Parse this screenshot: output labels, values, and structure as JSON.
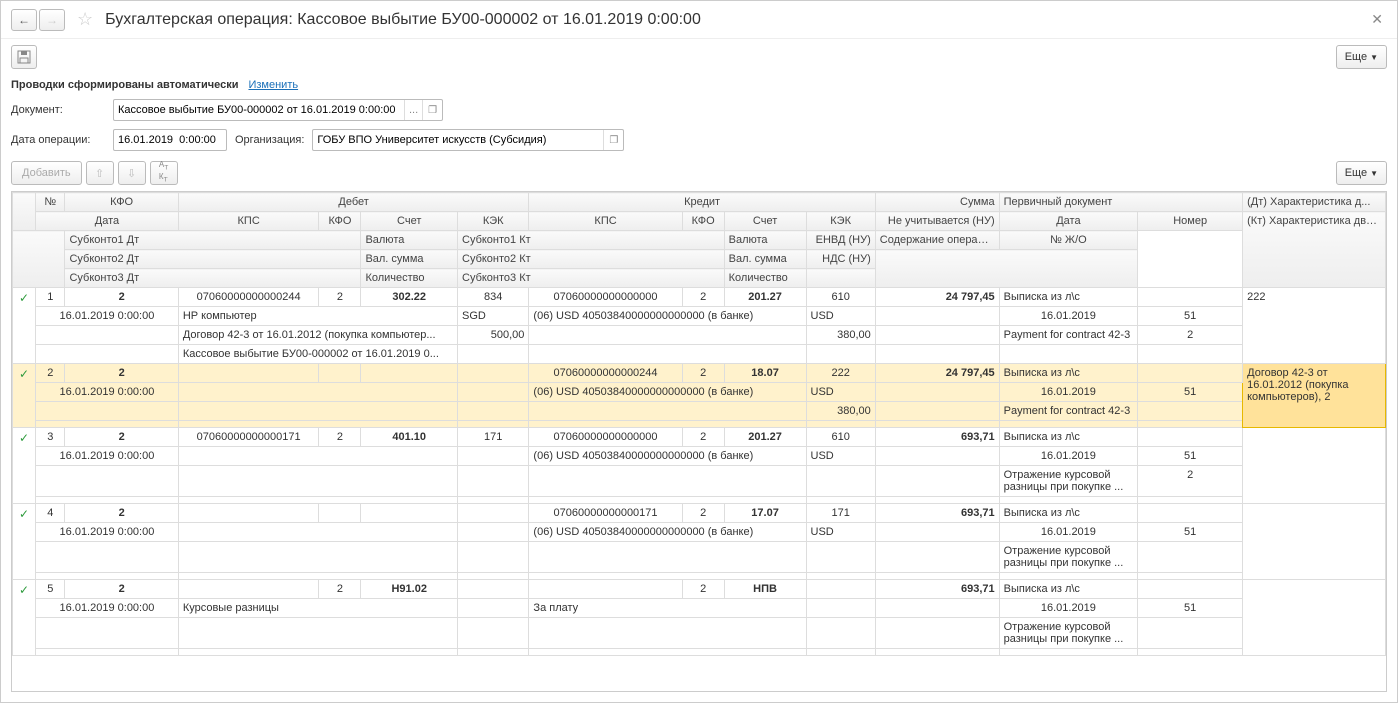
{
  "header": {
    "title": "Бухгалтерская операция: Кассовое выбытие БУ00-000002 от 16.01.2019 0:00:00"
  },
  "toolbar": {
    "more_label": "Еще"
  },
  "info": {
    "auto_text": "Проводки сформированы автоматически",
    "change_link": "Изменить"
  },
  "form": {
    "document_label": "Документ:",
    "document_value": "Кассовое выбытие БУ00-000002 от 16.01.2019 0:00:00",
    "date_label": "Дата операции:",
    "date_value": "16.01.2019  0:00:00",
    "org_label": "Организация:",
    "org_value": "ГОБУ ВПО Университет искусств (Субсидия)"
  },
  "buttons": {
    "add_label": "Добавить",
    "dtk_label": "Дт\nКт"
  },
  "grid": {
    "h_no": "№",
    "h_kfo": "КФО",
    "h_date": "Дата",
    "h_debit": "Дебет",
    "h_credit": "Кредит",
    "h_sum": "Сумма",
    "h_prim": "Первичный документ",
    "h_char_dt": "(Дт) Характеристика д...",
    "h_char_kt": "(Кт) Характеристика движения",
    "h_kps": "КПС",
    "h_kfo2": "КФО",
    "h_acct": "Счет",
    "h_kek": "КЭК",
    "h_ne": "Не учитывается (НУ)",
    "h_pdate": "Дата",
    "h_pnum": "Номер",
    "h_sub1d": "Субконто1 Дт",
    "h_sub2d": "Субконто2 Дт",
    "h_sub3d": "Субконто3 Дт",
    "h_sub1k": "Субконто1 Кт",
    "h_sub2k": "Субконто2 Кт",
    "h_sub3k": "Субконто3 Кт",
    "h_val": "Валюта",
    "h_valsum": "Вал. сумма",
    "h_qty": "Количество",
    "h_envd": "ЕНВД (НУ)",
    "h_nds": "НДС (НУ)",
    "h_content": "Содержание операции",
    "h_jno": "№ Ж/О"
  },
  "rows": [
    {
      "no": "1",
      "kfo": "2",
      "date": "16.01.2019 0:00:00",
      "d_kps": "07060000000000244",
      "d_kfo": "2",
      "d_acct": "302.22",
      "d_kek": "834",
      "k_kps": "07060000000000000",
      "k_kfo": "2",
      "k_acct": "201.27",
      "k_kek": "610",
      "sum": "24 797,45",
      "prim": "Выписка из л\\c",
      "sub1d": "НР компьютер",
      "sub1k": "(06) USD 40503840000000000000 (в банке)",
      "d_val": "SGD",
      "k_val": "USD",
      "k_valsum": "",
      "pdate": "16.01.2019",
      "pnum": "51",
      "char_dt": "222",
      "sub2d": "Договор 42-3 от 16.01.2012 (покупка компьютер...",
      "d_valsum": "500,00",
      "k_kek2": "380,00",
      "content": "Payment for contract 42-3",
      "jno": "2",
      "sub3d": "Кассовое выбытие БУ00-000002 от 16.01.2019 0..."
    },
    {
      "no": "2",
      "kfo": "2",
      "date": "16.01.2019 0:00:00",
      "d_kps": "",
      "d_kfo": "",
      "d_acct": "",
      "d_kek": "",
      "k_kps": "07060000000000244",
      "k_kfo": "2",
      "k_acct": "18.07",
      "k_kek": "222",
      "sum": "24 797,45",
      "prim": "Выписка из л\\c",
      "sub1d": "",
      "sub1k": "(06) USD 40503840000000000000 (в банке)",
      "d_val": "",
      "k_val": "USD",
      "k_valsum": "",
      "pdate": "16.01.2019",
      "pnum": "51",
      "char_dt": "",
      "char_kt": "Договор 42-3 от 16.01.2012 (покупка компьютеров), 2",
      "sub2d": "",
      "d_valsum": "",
      "k_kek2": "380,00",
      "content": "Payment for contract 42-3",
      "jno": "",
      "sub3d": ""
    },
    {
      "no": "3",
      "kfo": "2",
      "date": "16.01.2019 0:00:00",
      "d_kps": "07060000000000171",
      "d_kfo": "2",
      "d_acct": "401.10",
      "d_kek": "171",
      "k_kps": "07060000000000000",
      "k_kfo": "2",
      "k_acct": "201.27",
      "k_kek": "610",
      "sum": "693,71",
      "prim": "Выписка из л\\c",
      "sub1d": "",
      "sub1k": "(06) USD 40503840000000000000 (в банке)",
      "d_val": "",
      "k_val": "USD",
      "k_valsum": "",
      "pdate": "16.01.2019",
      "pnum": "51",
      "char_dt": "",
      "sub2d": "",
      "d_valsum": "",
      "k_kek2": "",
      "content": "Отражение курсовой разницы при покупке ...",
      "jno": "2",
      "sub3d": ""
    },
    {
      "no": "4",
      "kfo": "2",
      "date": "16.01.2019 0:00:00",
      "d_kps": "",
      "d_kfo": "",
      "d_acct": "",
      "d_kek": "",
      "k_kps": "07060000000000171",
      "k_kfo": "2",
      "k_acct": "17.07",
      "k_kek": "171",
      "sum": "693,71",
      "prim": "Выписка из л\\c",
      "sub1d": "",
      "sub1k": "(06) USD 40503840000000000000 (в банке)",
      "d_val": "",
      "k_val": "USD",
      "k_valsum": "",
      "pdate": "16.01.2019",
      "pnum": "51",
      "char_dt": "",
      "sub2d": "",
      "d_valsum": "",
      "k_kek2": "",
      "content": "Отражение курсовой разницы при покупке ...",
      "jno": "",
      "sub3d": ""
    },
    {
      "no": "5",
      "kfo": "2",
      "date": "16.01.2019 0:00:00",
      "d_kps": "",
      "d_kfo": "2",
      "d_acct": "Н91.02",
      "d_kek": "",
      "k_kps": "",
      "k_kfo": "2",
      "k_acct": "НПВ",
      "k_kek": "",
      "sum": "693,71",
      "prim": "Выписка из л\\c",
      "sub1d": "Курсовые разницы",
      "sub1k": "За плату",
      "d_val": "",
      "k_val": "",
      "k_valsum": "",
      "pdate": "16.01.2019",
      "pnum": "51",
      "char_dt": "",
      "sub2d": "",
      "d_valsum": "",
      "k_kek2": "",
      "content": "Отражение курсовой разницы при покупке ...",
      "jno": "",
      "sub3d": ""
    }
  ]
}
